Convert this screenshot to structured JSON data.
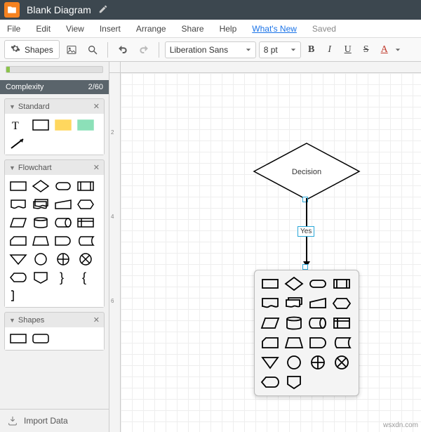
{
  "titlebar": {
    "title": "Blank Diagram"
  },
  "menubar": {
    "file": "File",
    "edit": "Edit",
    "view": "View",
    "insert": "Insert",
    "arrange": "Arrange",
    "share": "Share",
    "help": "Help",
    "whatsnew": "What's New",
    "saved": "Saved"
  },
  "toolbar": {
    "shapes_label": "Shapes",
    "font": "Liberation Sans",
    "size": "8 pt",
    "bold": "B",
    "italic": "I",
    "underline": "U",
    "strike": "S",
    "fontcolor": "A"
  },
  "complexity": {
    "label": "Complexity",
    "value": "2/60"
  },
  "sections": {
    "standard": "Standard",
    "flowchart": "Flowchart",
    "shapes": "Shapes"
  },
  "import": "Import Data",
  "canvas": {
    "decision_label": "Decision",
    "edge_label": "Yes"
  },
  "ruler": {
    "t1": "2",
    "t2": "4",
    "t3": "6"
  },
  "watermark": "wsxdn.com"
}
